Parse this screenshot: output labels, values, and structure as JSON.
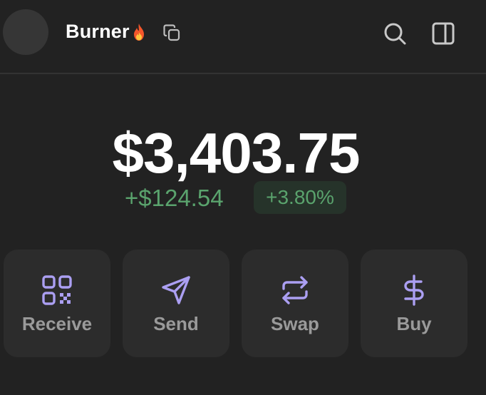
{
  "header": {
    "account_name": "Burner",
    "icons": [
      "fire-icon",
      "copy-icon",
      "search-icon",
      "sidebar-icon"
    ]
  },
  "portfolio": {
    "balance": "$3,403.75",
    "change_amount": "+$124.54",
    "change_percent": "+3.80%"
  },
  "actions": [
    {
      "label": "Receive",
      "icon": "qr-code-icon"
    },
    {
      "label": "Send",
      "icon": "send-icon"
    },
    {
      "label": "Swap",
      "icon": "swap-icon"
    },
    {
      "label": "Buy",
      "icon": "dollar-icon"
    }
  ],
  "colors": {
    "background": "#222222",
    "accent": "#ab9ff2",
    "positive": "#5aa36d",
    "button_background": "#2c2c2c"
  }
}
